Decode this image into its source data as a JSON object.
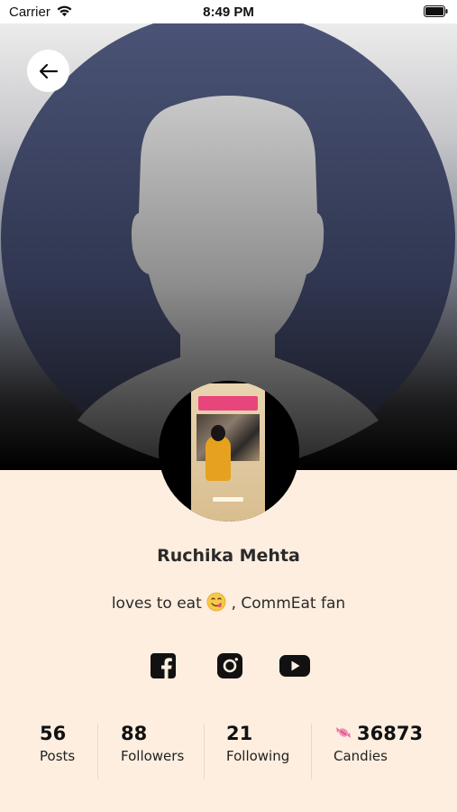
{
  "status_bar": {
    "carrier": "Carrier",
    "time": "8:49 PM"
  },
  "profile": {
    "name": "Ruchika Mehta",
    "bio_before": "loves to eat",
    "bio_after": ",  CommEat fan"
  },
  "social_links": [
    {
      "icon": "facebook-icon"
    },
    {
      "icon": "instagram-icon"
    },
    {
      "icon": "youtube-icon"
    }
  ],
  "stats": {
    "posts": {
      "value": "56",
      "label": "Posts"
    },
    "followers": {
      "value": "88",
      "label": "Followers"
    },
    "following": {
      "value": "21",
      "label": "Following"
    },
    "candies": {
      "value": "36873",
      "label": "Candies"
    }
  },
  "colors": {
    "background": "#fdeedf",
    "cover_silhouette": "#4a5270",
    "candy_pink": "#f06fa8"
  }
}
